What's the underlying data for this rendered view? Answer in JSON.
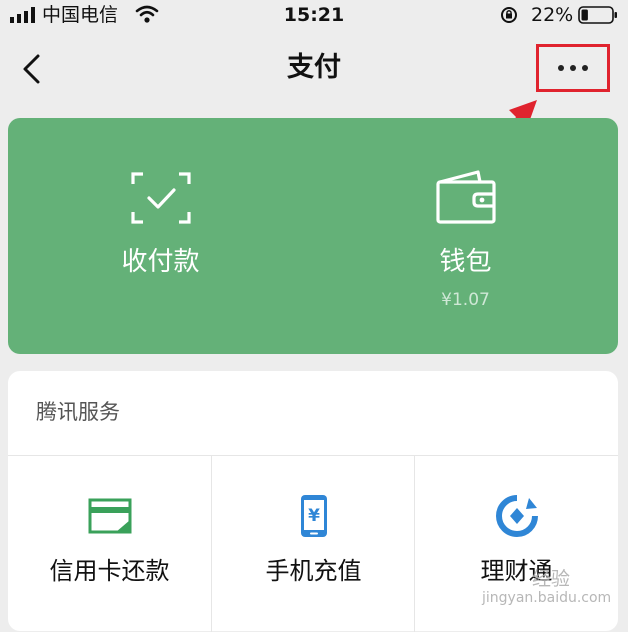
{
  "status_bar": {
    "carrier": "中国电信",
    "time": "15:21",
    "battery_percent": "22%",
    "battery_level": 0.22
  },
  "nav": {
    "title": "支付",
    "highlight_color": "#e0232e"
  },
  "pay_card": {
    "color": "#64b178",
    "receive": {
      "label": "收付款",
      "icon": "qr-scan-icon"
    },
    "wallet": {
      "label": "钱包",
      "amount": "¥1.07",
      "icon": "wallet-icon"
    }
  },
  "services": {
    "title": "腾讯服务",
    "items": [
      {
        "label": "信用卡还款",
        "icon": "credit-card-icon"
      },
      {
        "label": "手机充值",
        "icon": "mobile-topup-icon"
      },
      {
        "label": "理财通",
        "icon": "wealth-icon"
      }
    ]
  },
  "watermark": {
    "brand": "经验",
    "domain": "jingyan.baidu.com"
  }
}
